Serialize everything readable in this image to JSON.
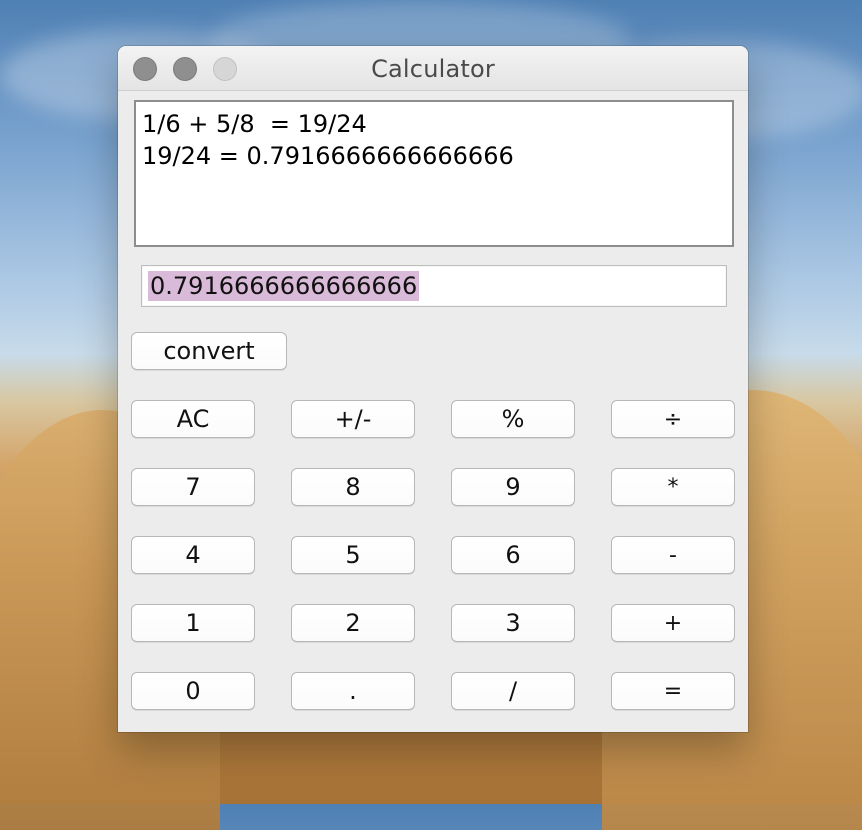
{
  "window": {
    "title": "Calculator"
  },
  "history": {
    "lines": [
      "1/6 + 5/8  = 19/24",
      "19/24 = 0.7916666666666666"
    ]
  },
  "result": {
    "value": "0.7916666666666666"
  },
  "buttons": {
    "convert": "convert",
    "row1": [
      "AC",
      "+/-",
      "%",
      "÷"
    ],
    "row2": [
      "7",
      "8",
      "9",
      "*"
    ],
    "row3": [
      "4",
      "5",
      "6",
      "-"
    ],
    "row4": [
      "1",
      "2",
      "3",
      "+"
    ],
    "row5": [
      "0",
      ".",
      "/",
      "="
    ]
  },
  "colors": {
    "selection": "#d9bad9",
    "window_bg": "#ececec",
    "title_text": "#4a4a4a"
  }
}
